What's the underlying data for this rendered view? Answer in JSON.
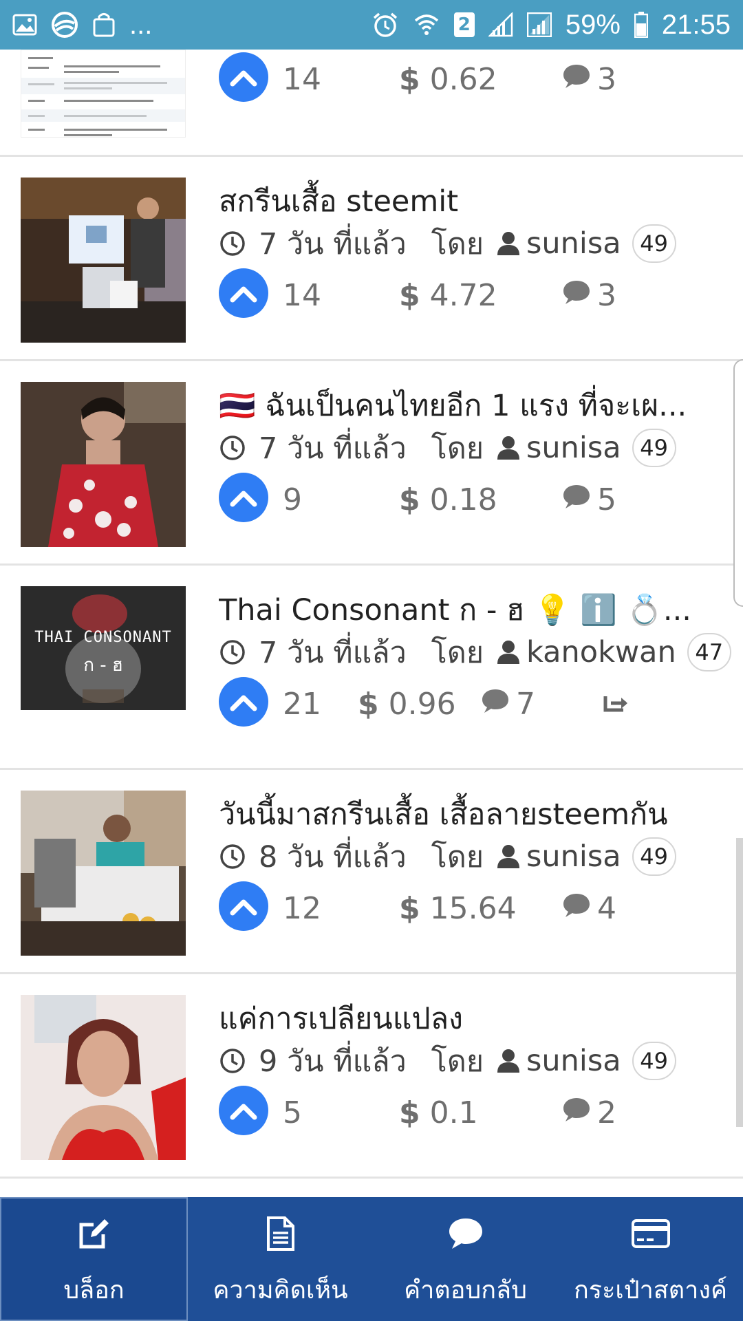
{
  "status_bar": {
    "overflow": "...",
    "sim_badge": "2",
    "battery": "59%",
    "time": "21:55"
  },
  "posts": [
    {
      "title": "",
      "time": "",
      "by": "",
      "author": "",
      "rep": "",
      "votes": "14",
      "payout": "0.62",
      "comments": "3",
      "thumb_lines": [
        "HISTORY",
        "6 hours ago",
        "yesterday",
        "3 days ago",
        "4 days ago",
        "4 days ago"
      ]
    },
    {
      "title": "สกรีนเสื้อ steemit",
      "time": "7 วัน ที่แล้ว",
      "by": "โดย",
      "author": "sunisa",
      "rep": "49",
      "votes": "14",
      "payout": "4.72",
      "comments": "3"
    },
    {
      "title": "🇹🇭 ฉันเป็นคนไทยอีก 1 แรง ที่จะเผ...",
      "time": "7 วัน ที่แล้ว",
      "by": "โดย",
      "author": "sunisa",
      "rep": "49",
      "votes": "9",
      "payout": "0.18",
      "comments": "5"
    },
    {
      "title": "Thai Consonant ก - ฮ 💡 ℹ️ 💍...",
      "time": "7 วัน ที่แล้ว",
      "by": "โดย",
      "author": "kanokwan",
      "rep": "47",
      "votes": "21",
      "payout": "0.96",
      "comments": "7",
      "thumb_text_1": "THAI CONSONANT",
      "thumb_text_2": "ก - ฮ"
    },
    {
      "title": "วันนี้มาสกรีนเสื้อ เสื้อลายsteemกัน",
      "time": "8 วัน ที่แล้ว",
      "by": "โดย",
      "author": "sunisa",
      "rep": "49",
      "votes": "12",
      "payout": "15.64",
      "comments": "4"
    },
    {
      "title": "แค่การเปลียนแปลง",
      "time": "9 วัน ที่แล้ว",
      "by": "โดย",
      "author": "sunisa",
      "rep": "49",
      "votes": "5",
      "payout": "0.1",
      "comments": "2"
    }
  ],
  "currency_symbol": "$",
  "bottom_nav": [
    {
      "label": "บล็อก",
      "icon": "edit-icon"
    },
    {
      "label": "ความคิดเห็น",
      "icon": "document-icon"
    },
    {
      "label": "คำตอบกลับ",
      "icon": "chat-icon"
    },
    {
      "label": "กระเป๋าสตางค์",
      "icon": "credit-card-icon"
    }
  ],
  "colors": {
    "status_bar": "#4a9ec2",
    "upvote": "#2f7df4",
    "bottom_nav": "#1f4f97"
  }
}
